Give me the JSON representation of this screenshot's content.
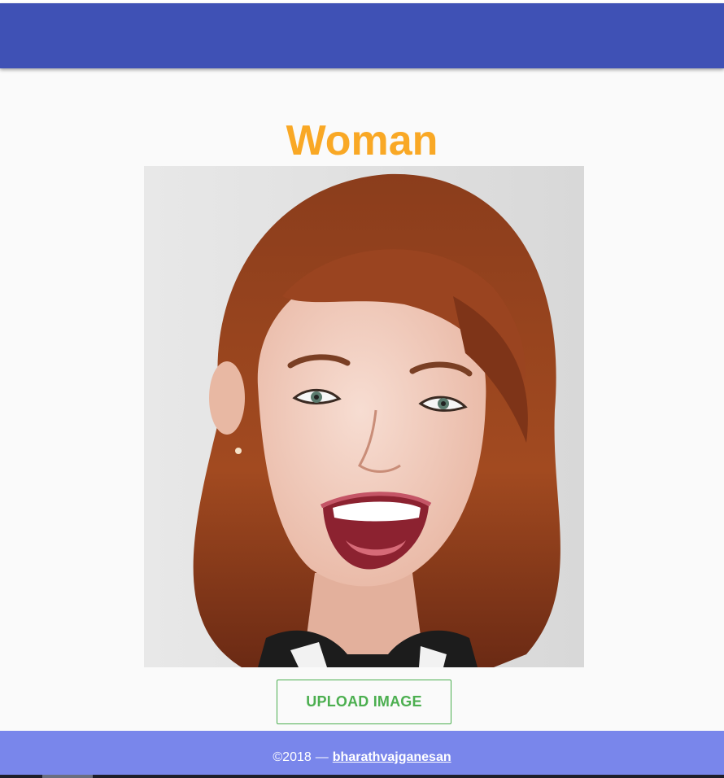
{
  "colors": {
    "app_bar": "#3f51b5",
    "title": "#f9a825",
    "button": "#4caf50",
    "footer": "#7986eb",
    "background": "#fafafa"
  },
  "result": {
    "label": "Woman"
  },
  "photo": {
    "icon": "portrait-photo"
  },
  "upload": {
    "label": "UPLOAD IMAGE"
  },
  "footer": {
    "copyright": "©2018",
    "dash": "—",
    "author_link": "bharathvajganesan"
  }
}
